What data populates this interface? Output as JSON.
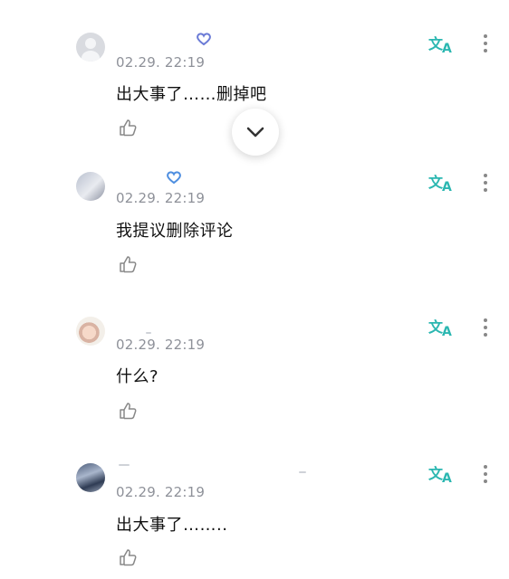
{
  "comments": [
    {
      "date": "02.29. 22:19",
      "text": "出大事了……删掉吧"
    },
    {
      "date": "02.29. 22:19",
      "text": "我提议删除评论"
    },
    {
      "date": "02.29. 22:19",
      "text": "什么?"
    },
    {
      "date": "02.29. 22:19",
      "text": "出大事了…….."
    }
  ],
  "icons": {
    "like": "thumbs-up-icon",
    "translate": "translate-icon",
    "more": "more-vertical-icon",
    "scroll": "chevron-down-icon",
    "badge": "heart-badge-icon"
  },
  "colors": {
    "accent": "#2bb7b1",
    "date": "#8e9199",
    "badge": "#6b7bd6"
  }
}
